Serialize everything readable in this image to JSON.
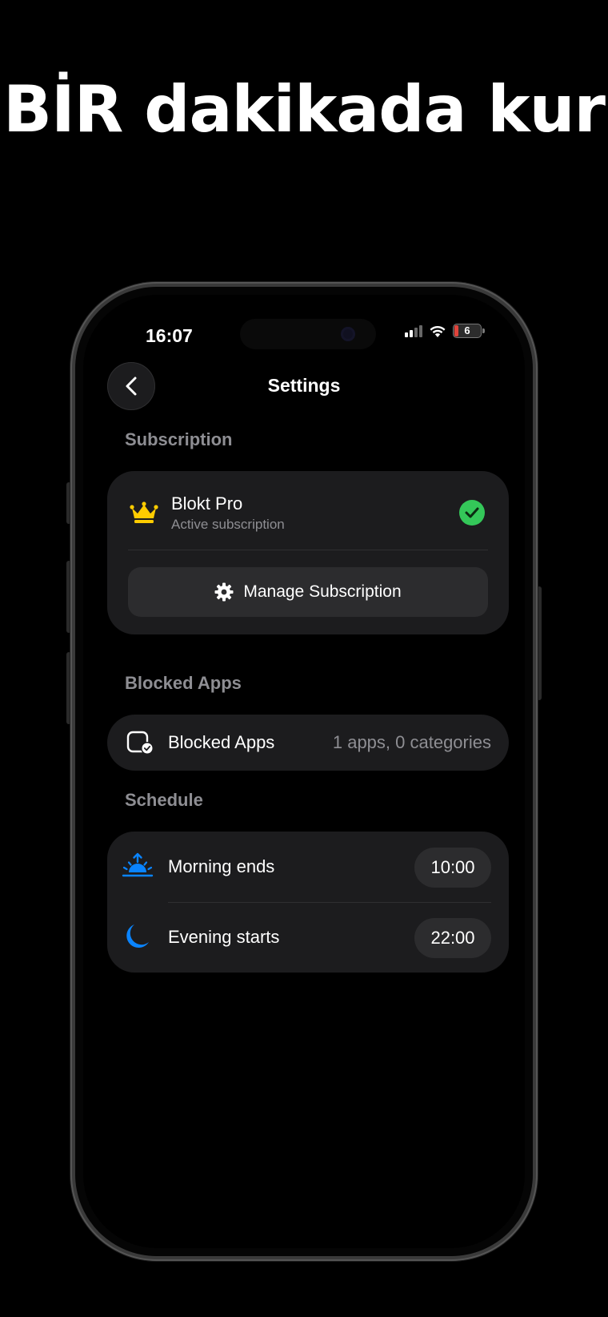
{
  "headline": "BİR dakikada kur",
  "status_bar": {
    "time": "16:07",
    "battery": "6"
  },
  "nav": {
    "title": "Settings"
  },
  "subscription": {
    "section_label": "Subscription",
    "plan_name": "Blokt Pro",
    "status_text": "Active subscription",
    "manage_label": "Manage Subscription"
  },
  "blocked_apps": {
    "section_label": "Blocked Apps",
    "row_label": "Blocked Apps",
    "row_value": "1 apps, 0 categories"
  },
  "schedule": {
    "section_label": "Schedule",
    "rows": [
      {
        "label": "Morning ends",
        "time": "10:00",
        "icon": "sunrise-icon"
      },
      {
        "label": "Evening starts",
        "time": "22:00",
        "icon": "moon-icon"
      }
    ]
  },
  "colors": {
    "background": "#000000",
    "card": "#1c1c1e",
    "accent_blue": "#0a84ff",
    "success_green": "#34c759",
    "crown_yellow": "#ffcc00",
    "secondary_text": "#8e8e93"
  }
}
